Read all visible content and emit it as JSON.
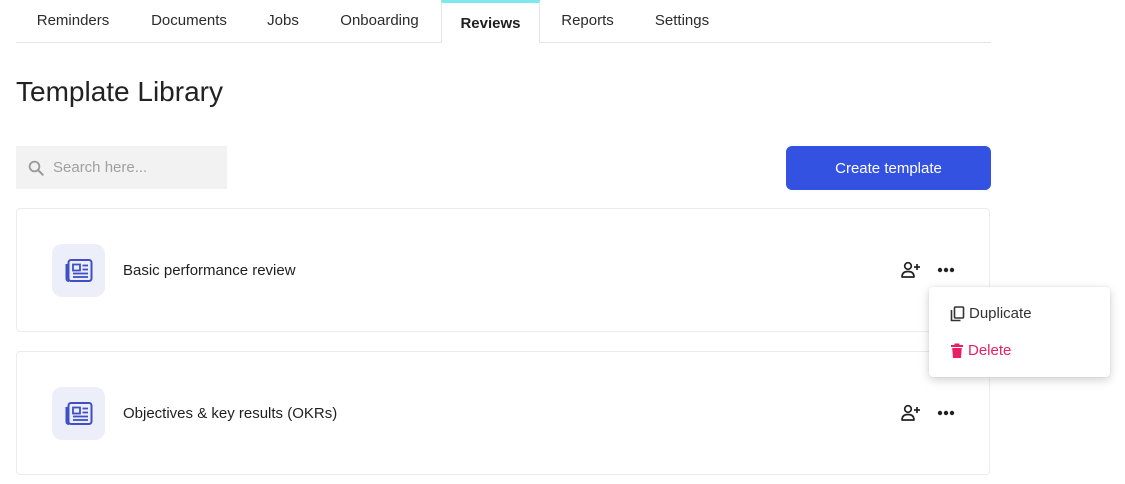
{
  "tabs": [
    {
      "label": "Reminders",
      "active": false
    },
    {
      "label": "Documents",
      "active": false
    },
    {
      "label": "Jobs",
      "active": false
    },
    {
      "label": "Onboarding",
      "active": false
    },
    {
      "label": "Reviews",
      "active": true
    },
    {
      "label": "Reports",
      "active": false
    },
    {
      "label": "Settings",
      "active": false
    }
  ],
  "page": {
    "title": "Template Library"
  },
  "search": {
    "placeholder": "Search here...",
    "value": "",
    "icon": "search-icon"
  },
  "toolbar": {
    "create_label": "Create template"
  },
  "templates": [
    {
      "title": "Basic performance review",
      "icon": "newspaper-icon"
    },
    {
      "title": "Objectives & key results (OKRs)",
      "icon": "newspaper-icon"
    }
  ],
  "context_menu": {
    "items": [
      {
        "label": "Duplicate",
        "icon": "copy-icon"
      },
      {
        "label": "Delete",
        "icon": "trash-icon"
      }
    ]
  },
  "colors": {
    "accent": "#3452e1",
    "active_tab_indicator": "#7ee8ee",
    "danger": "#e91e63",
    "icon_tile": "#eceefa",
    "icon_stroke": "#3f4fc4"
  }
}
